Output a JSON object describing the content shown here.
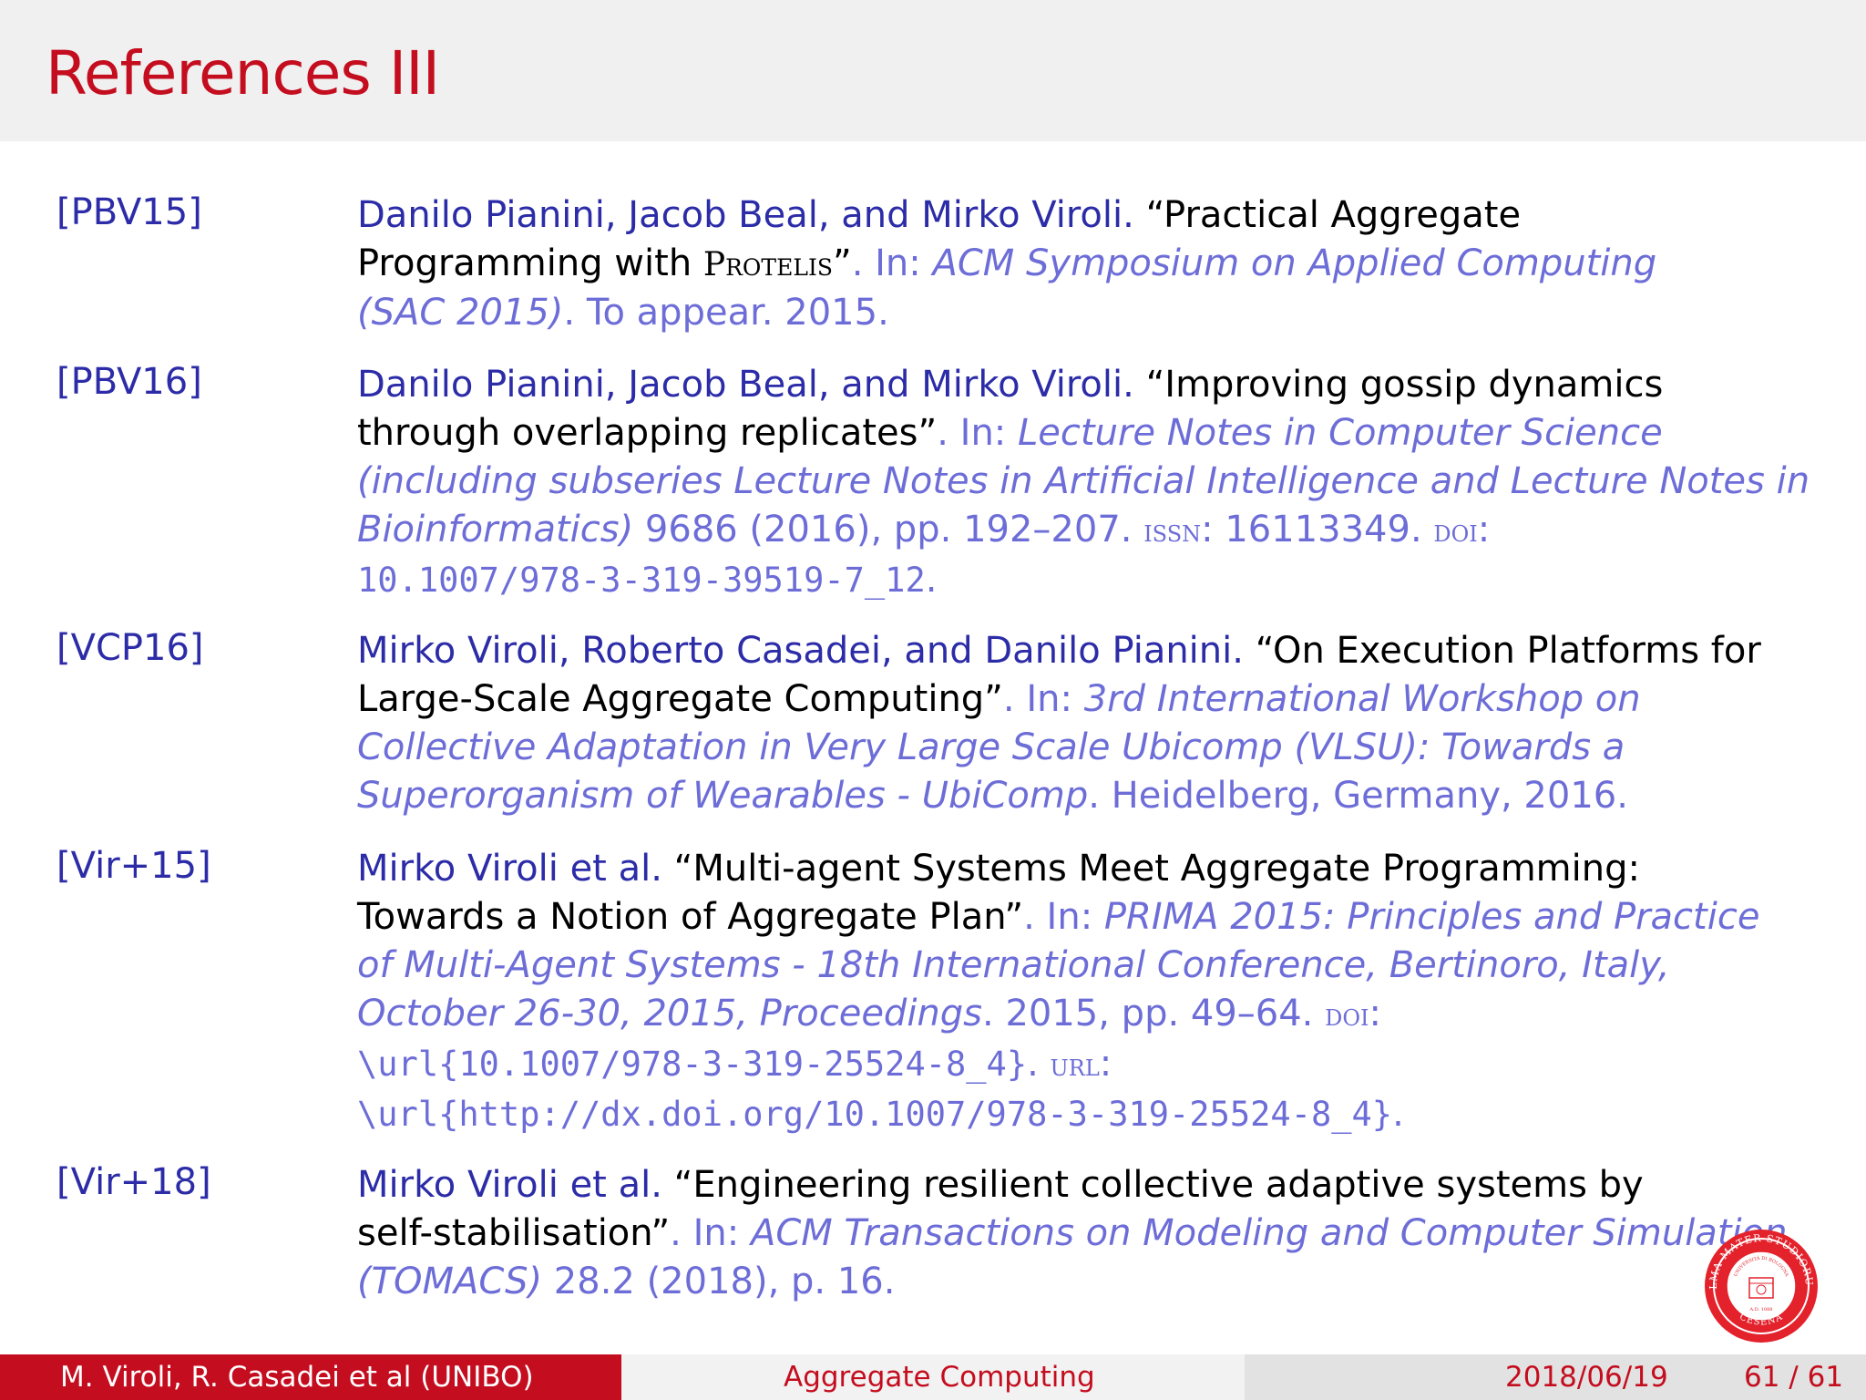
{
  "title": "References III",
  "refs": [
    {
      "key": "[PBV15]",
      "authors": "Danilo Pianini, Jacob Beal, and Mirko Viroli.",
      "title_a": "“Practical Aggregate",
      "title_b": "Programming with ",
      "title_sc": "Protelis",
      "title_c": "”",
      "in": ". In: ",
      "venue_a": "ACM Symposium on Applied Computing",
      "venue_b": "(SAC 2015)",
      "rest": ". To appear. 2015."
    },
    {
      "key": "[PBV16]",
      "authors": "Danilo Pianini, Jacob Beal, and Mirko Viroli.",
      "title_a": "“Improving gossip dynamics",
      "title_b": "through overlapping replicates”",
      "in": ". In: ",
      "venue_a": "Lecture Notes in Computer Science",
      "venue_b": "(including subseries Lecture Notes in Artificial Intelligence and Lecture Notes in",
      "venue_c": "Bioinformatics)",
      "rest_a": " 9686 (2016), pp. 192–207. ",
      "issn_label": "issn",
      "issn": ": 16113349. ",
      "doi_label": "doi",
      "doi_colon": ":",
      "doi": "10.1007/978-3-319-39519-7_12",
      "end": "."
    },
    {
      "key": "[VCP16]",
      "authors": "Mirko Viroli, Roberto Casadei, and Danilo Pianini.",
      "title_a": "“On Execution Platforms for",
      "title_b": "Large-Scale Aggregate Computing”",
      "in": ". In: ",
      "venue_a": "3rd International Workshop on",
      "venue_b": "Collective Adaptation in Very Large Scale Ubicomp (VLSU): Towards a",
      "venue_c": "Superorganism of Wearables - UbiComp",
      "rest": ". Heidelberg, Germany, 2016."
    },
    {
      "key": "[Vir+15]",
      "authors": "Mirko Viroli et al.",
      "title_a": "“Multi-agent Systems Meet Aggregate Programming:",
      "title_b": "Towards a Notion of Aggregate Plan”",
      "in": ". In: ",
      "venue_a": "PRIMA 2015: Principles and Practice",
      "venue_b": "of Multi-Agent Systems - 18th International Conference, Bertinoro, Italy,",
      "venue_c": "October 26-30, 2015, Proceedings",
      "rest": ". 2015, pp. 49–64. ",
      "doi_label": "doi",
      "doi_colon": ":",
      "doi": "\\url{10.1007/978-3-319-25524-8_4}",
      "url_label_pre": ". ",
      "url_label": "url",
      "url_colon": ":",
      "url": "\\url{http://dx.doi.org/10.1007/978-3-319-25524-8_4}",
      "end": "."
    },
    {
      "key": "[Vir+18]",
      "authors": "Mirko Viroli et al.",
      "title_a": "“Engineering resilient collective adaptive systems by",
      "title_b": "self-stabilisation”",
      "in": ". In: ",
      "venue_a": "ACM Transactions on Modeling and Computer Simulation",
      "venue_b": "(TOMACS)",
      "rest": " 28.2 (2018), p. 16."
    }
  ],
  "footer": {
    "authors": "M. Viroli, R. Casadei et al  (UNIBO)",
    "talk": "Aggregate Computing",
    "date": "2018/06/19",
    "page": "61 / 61"
  },
  "logo": {
    "icon": "university-seal-icon",
    "text_top": "ALMA MATER STUDIORUM",
    "text_bottom": "CESENA",
    "text_inner": "UNIVERSITÀ DI BOLOGNA",
    "year": "A.D. 1088"
  },
  "colors": {
    "accent": "#c40d1e",
    "author": "#2c2ca8",
    "venue": "#6d6dd8"
  }
}
